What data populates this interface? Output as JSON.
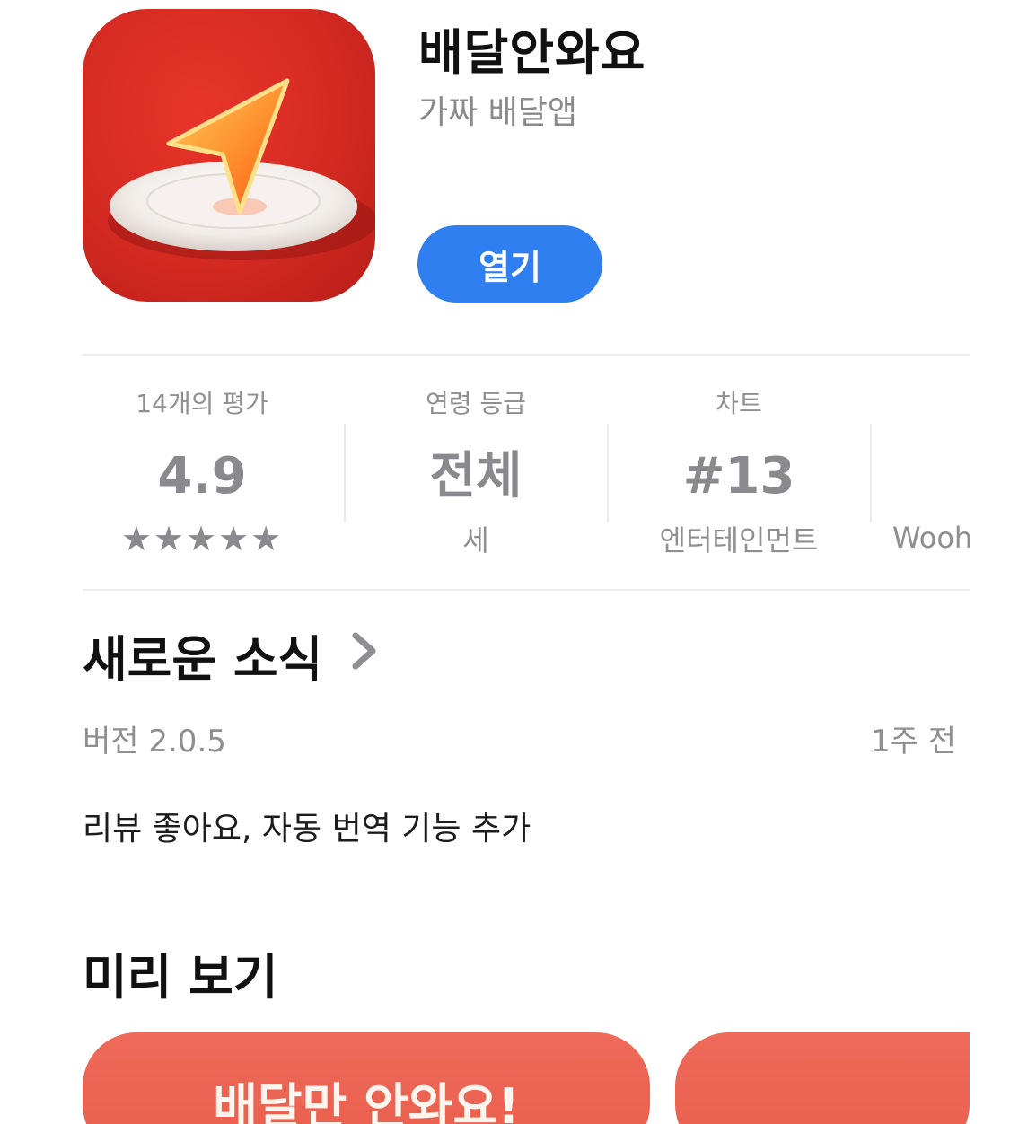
{
  "app": {
    "title": "배달안와요",
    "subtitle": "가짜 배달앱",
    "open_label": "열기",
    "icon": "delivery-arrow-plate-icon",
    "accent": "#2f7ff0",
    "icon_bg": "#d42a22"
  },
  "info": {
    "ratings": {
      "label": "14개의 평가",
      "value": "4.9",
      "stars": "★★★★★",
      "star_rating": 4.9
    },
    "age": {
      "label": "연령 등급",
      "value": "전체",
      "sub": "세"
    },
    "chart": {
      "label": "차트",
      "value": "#13",
      "sub": "엔터테인먼트"
    },
    "developer": {
      "sub": "Wooh"
    }
  },
  "whats_new": {
    "title": "새로운 소식",
    "version": "버전 2.0.5",
    "when": "1주 전",
    "notes": "리뷰 좋아요, 자동 번역 기능 추가"
  },
  "preview": {
    "title": "미리 보기",
    "shot1_text": "배달만 안와요!"
  }
}
